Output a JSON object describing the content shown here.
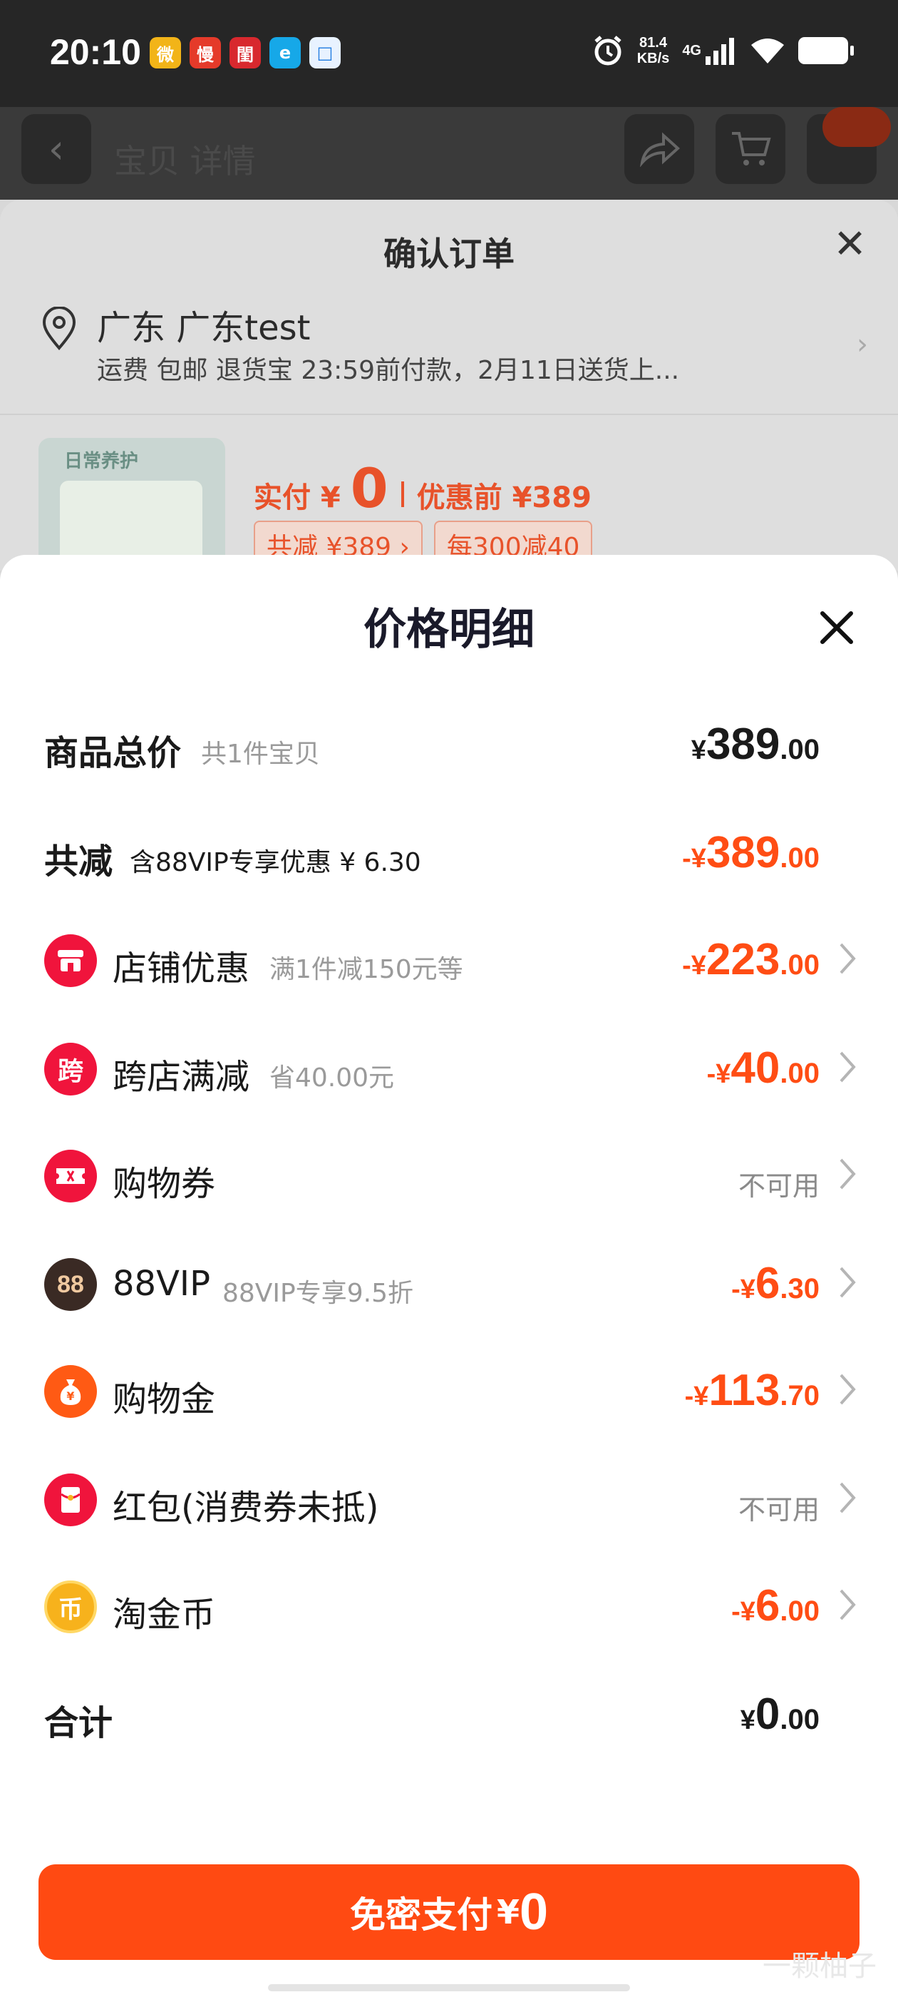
{
  "status_bar": {
    "time": "20:10",
    "net_speed_value": "81.4",
    "net_speed_unit": "KB/s",
    "network": "4G",
    "apps": [
      "微",
      "慢",
      "閨",
      "e",
      "□"
    ]
  },
  "page_header": {
    "title": "宝贝 详情"
  },
  "order_sheet": {
    "title": "确认订单",
    "address_main": "广东 广东test",
    "address_sub": "运费 包邮 退货宝 23:59前付款，2月11日送货上...",
    "thumb_label": "日常养护",
    "paid_label": "实付 ¥",
    "paid_value": "0",
    "before_label": "优惠前 ¥389",
    "tags": [
      "共减 ¥389 ›",
      "每300减40"
    ]
  },
  "detail": {
    "title": "价格明细",
    "rows": [
      {
        "label": "商品总价",
        "sub": "共1件宝贝",
        "currency": "¥",
        "int": "389",
        "dec": ".00"
      },
      {
        "label": "共减",
        "sub": "含88VIP专享优惠 ¥ 6.30",
        "currency": "-¥",
        "int": "389",
        "dec": ".00"
      },
      {
        "label": "店铺优惠",
        "sub": "满1件减150元等",
        "currency": "-¥",
        "int": "223",
        "dec": ".00",
        "icon": "shop-icon"
      },
      {
        "label": "跨店满减",
        "sub": "省40.00元",
        "currency": "-¥",
        "int": "40",
        "dec": ".00",
        "icon": "cross-store-icon",
        "icon_text": "跨"
      },
      {
        "label": "购物券",
        "status": "不可用",
        "icon": "coupon-icon"
      },
      {
        "label": "88VIP",
        "sub": "88VIP专享9.5折",
        "currency": "-¥",
        "int": "6",
        "dec": ".30",
        "icon": "vip-icon",
        "icon_text": "88"
      },
      {
        "label": "购物金",
        "currency": "-¥",
        "int": "113",
        "dec": ".70",
        "icon": "money-bag-icon"
      },
      {
        "label": "红包(消费券未抵)",
        "status": "不可用",
        "icon": "red-packet-icon"
      },
      {
        "label": "淘金币",
        "currency": "-¥",
        "int": "6",
        "dec": ".00",
        "icon": "gold-coin-icon",
        "icon_text": "币"
      },
      {
        "label": "合计",
        "currency": "¥",
        "int": "0",
        "dec": ".00"
      }
    ]
  },
  "pay_button": {
    "label": "免密支付",
    "currency": "¥",
    "value": "0"
  },
  "watermark": "一颗柚子",
  "colors": {
    "accent": "#ff4a12",
    "discount_red": "#ff4d14",
    "icon_red": "#f0143c",
    "vip_dark": "#3a2a24",
    "money_orange": "#ff5a14",
    "coin_gold": "#f7b21c"
  }
}
